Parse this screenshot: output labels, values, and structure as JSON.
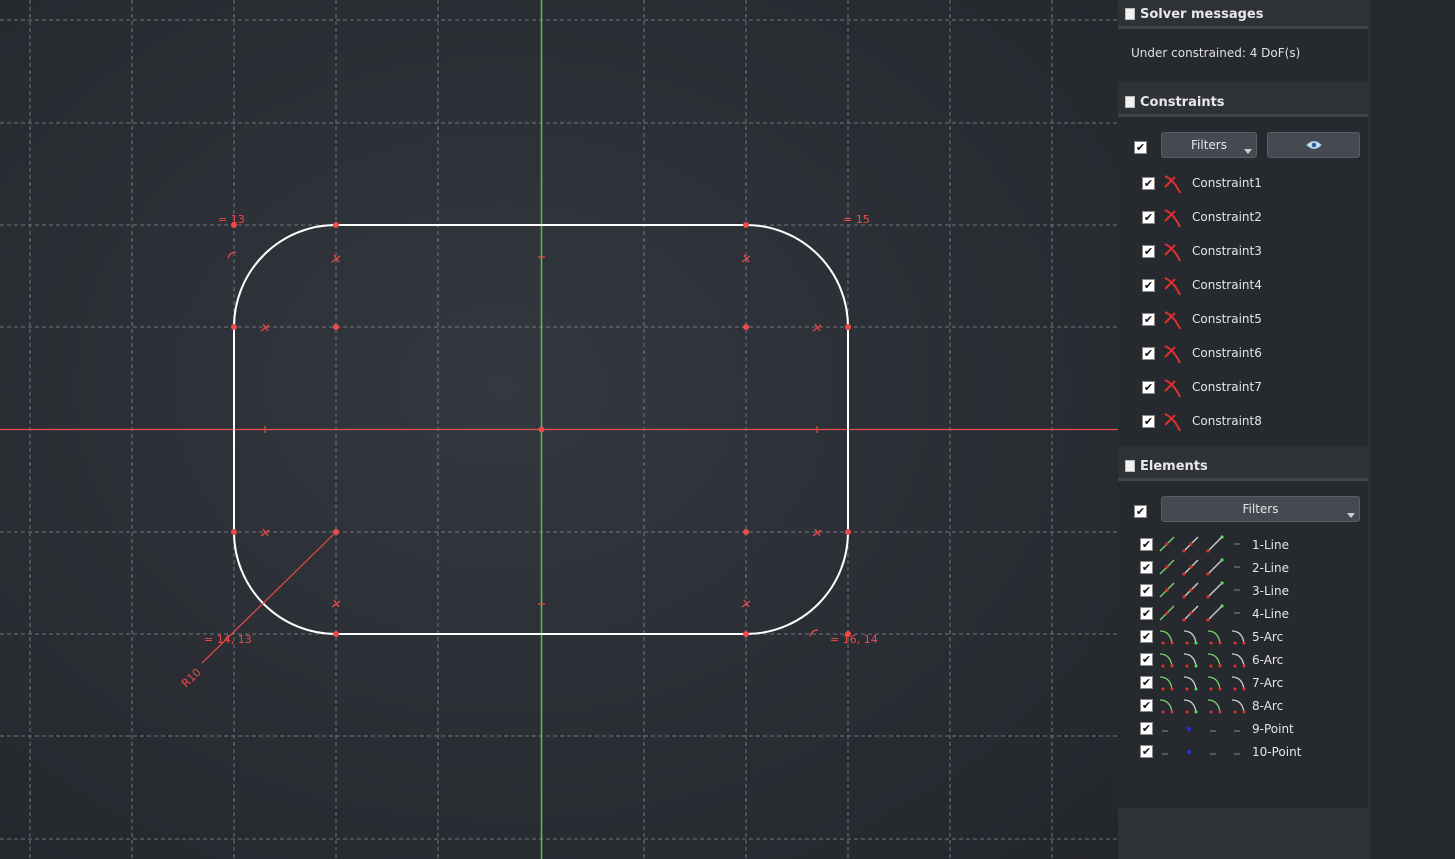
{
  "solver": {
    "title": "Solver messages",
    "message": "Under constrained:  4 DoF(s)"
  },
  "constraints": {
    "title": "Constraints",
    "filters_label": "Filters",
    "visibility_icon": "eye-icon",
    "items": [
      {
        "label": "Constraint1",
        "checked": true
      },
      {
        "label": "Constraint2",
        "checked": true
      },
      {
        "label": "Constraint3",
        "checked": true
      },
      {
        "label": "Constraint4",
        "checked": true
      },
      {
        "label": "Constraint5",
        "checked": true
      },
      {
        "label": "Constraint6",
        "checked": true
      },
      {
        "label": "Constraint7",
        "checked": true
      },
      {
        "label": "Constraint8",
        "checked": true
      }
    ]
  },
  "elements": {
    "title": "Elements",
    "filters_label": "Filters",
    "items": [
      {
        "label": "1-Line",
        "kind": "line"
      },
      {
        "label": "2-Line",
        "kind": "line"
      },
      {
        "label": "3-Line",
        "kind": "line"
      },
      {
        "label": "4-Line",
        "kind": "line"
      },
      {
        "label": "5-Arc",
        "kind": "arc"
      },
      {
        "label": "6-Arc",
        "kind": "arc"
      },
      {
        "label": "7-Arc",
        "kind": "arc"
      },
      {
        "label": "8-Arc",
        "kind": "arc"
      },
      {
        "label": "9-Point",
        "kind": "point"
      },
      {
        "label": "10-Point",
        "kind": "point"
      }
    ]
  },
  "sketch": {
    "labels": {
      "top_left": "= 13",
      "top_right": "= 15",
      "bottom_left": "= 14, 13",
      "bottom_right": "= 16, 14",
      "radius": "R10"
    },
    "colors": {
      "geometry": "#ffffff",
      "constraint": "#ee4a4a",
      "x_axis": "#e05050",
      "y_axis": "#4ec24e",
      "grid": "#8a8e94"
    }
  }
}
